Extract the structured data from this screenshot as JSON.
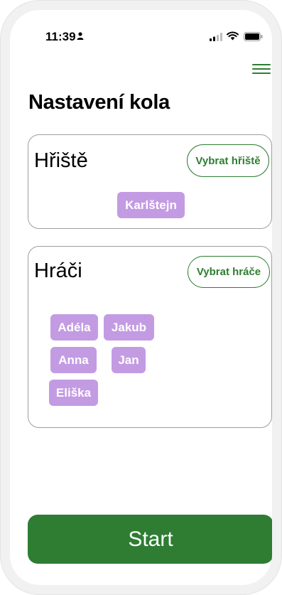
{
  "status_bar": {
    "time": "11:39"
  },
  "page_title": "Nastavení kola",
  "field_section": {
    "title": "Hřiště",
    "select_button": "Vybrat hřiště",
    "selected": [
      "Karlštejn"
    ]
  },
  "players_section": {
    "title": "Hráči",
    "select_button": "Vybrat hráče",
    "players": [
      "Adéla",
      "Jakub",
      "Anna",
      "Jan",
      "Eliška"
    ]
  },
  "start_button": "Start",
  "colors": {
    "accent": "#2e7d32",
    "chip": "#c39be3"
  }
}
